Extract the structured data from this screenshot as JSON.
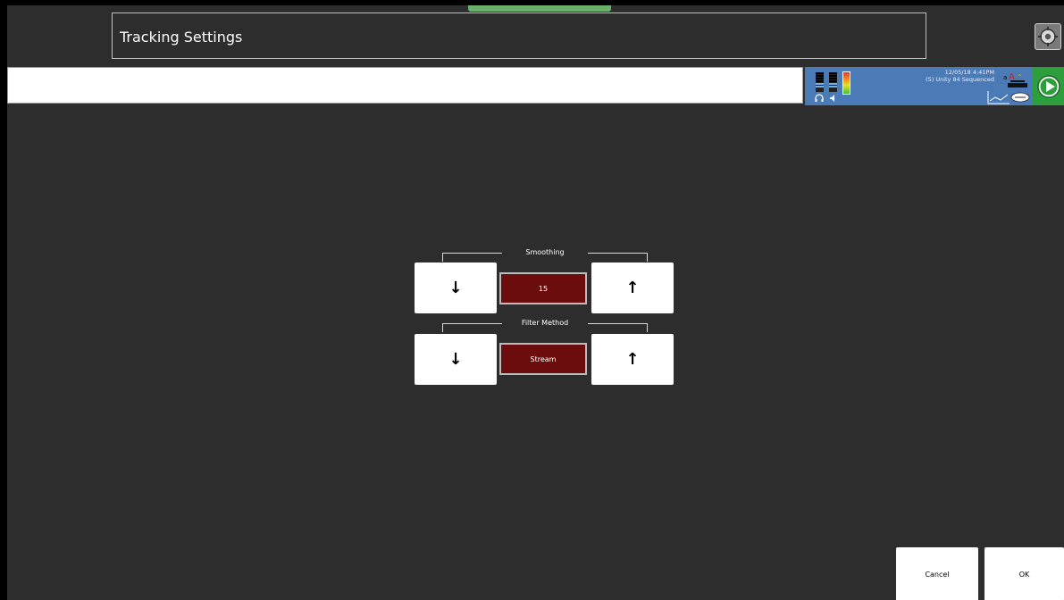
{
  "header": {
    "title": "Tracking Settings",
    "settings_icon": "gear-icon"
  },
  "status": {
    "datetime": "12/05/18 4:41PM",
    "sequence": "(5) Unity 84 Sequenced",
    "icons": [
      "headphones-icon",
      "speaker-icon",
      "battery-icon",
      "font-size-icon",
      "keyboard-icon",
      "chart-icon",
      "speech-icon",
      "play-icon"
    ]
  },
  "smoothing": {
    "label": "Smoothing",
    "value": "15",
    "down_symbol": "↓",
    "up_symbol": "↑"
  },
  "filter_method": {
    "label": "Filter Method",
    "value": "Stream",
    "down_symbol": "↓",
    "up_symbol": "↑"
  },
  "footer": {
    "cancel_label": "Cancel",
    "ok_label": "OK"
  },
  "colors": {
    "background": "#2d2d2d",
    "value_box": "#6b0d0d",
    "status_panel": "#4a7bb7",
    "play_box": "#2d9e3c"
  }
}
